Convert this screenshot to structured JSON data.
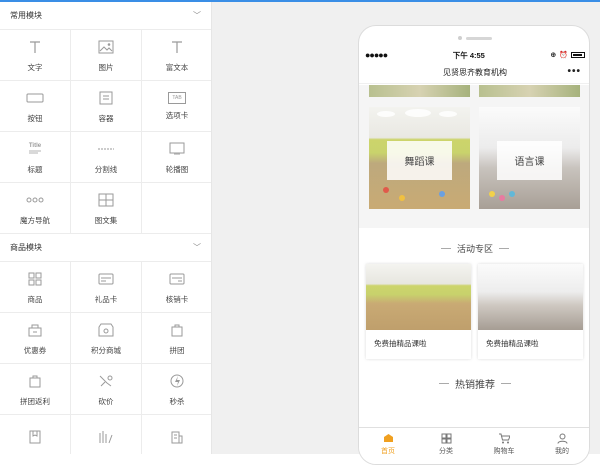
{
  "left_panel": {
    "sections": [
      {
        "title": "常用模块",
        "items": [
          {
            "label": "文字",
            "icon": "text-T-icon"
          },
          {
            "label": "图片",
            "icon": "image-icon"
          },
          {
            "label": "富文本",
            "icon": "rich-text-T-icon"
          },
          {
            "label": "按钮",
            "icon": "button-icon"
          },
          {
            "label": "容器",
            "icon": "container-icon"
          },
          {
            "label": "选项卡",
            "icon": "tab-icon"
          },
          {
            "label": "标题",
            "icon": "title-icon"
          },
          {
            "label": "分割线",
            "icon": "divider-icon"
          },
          {
            "label": "轮播图",
            "icon": "carousel-icon"
          },
          {
            "label": "魔方导航",
            "icon": "cube-nav-icon"
          },
          {
            "label": "图文集",
            "icon": "image-text-icon"
          }
        ]
      },
      {
        "title": "商品模块",
        "items": [
          {
            "label": "商品",
            "icon": "goods-grid-icon"
          },
          {
            "label": "礼品卡",
            "icon": "gift-card-icon"
          },
          {
            "label": "核销卡",
            "icon": "verify-card-icon"
          },
          {
            "label": "优惠券",
            "icon": "coupon-icon"
          },
          {
            "label": "积分商城",
            "icon": "points-mall-icon"
          },
          {
            "label": "拼团",
            "icon": "group-buy-icon"
          },
          {
            "label": "拼团返利",
            "icon": "group-rebate-icon"
          },
          {
            "label": "砍价",
            "icon": "bargain-icon"
          },
          {
            "label": "秒杀",
            "icon": "flash-sale-icon"
          }
        ]
      }
    ],
    "title_icon_text": "Title",
    "tab_icon_text": "TAB"
  },
  "phone": {
    "status_time": "下午 4:55",
    "status_dots": "●●●●●",
    "page_title": "见贤思齐教育机构",
    "more": "•••",
    "courses": [
      "舞蹈课",
      "语言课"
    ],
    "activity_title": "活动专区",
    "activities": [
      "免费抽精品课啦",
      "免费抽精品课啦"
    ],
    "hot_title": "热销推荐",
    "tabs": [
      {
        "label": "首页",
        "active": true
      },
      {
        "label": "分类",
        "active": false
      },
      {
        "label": "购物车",
        "active": false
      },
      {
        "label": "我的",
        "active": false
      }
    ]
  },
  "colors": {
    "accent": "#f0a020",
    "topline": "#3a8ee6"
  }
}
